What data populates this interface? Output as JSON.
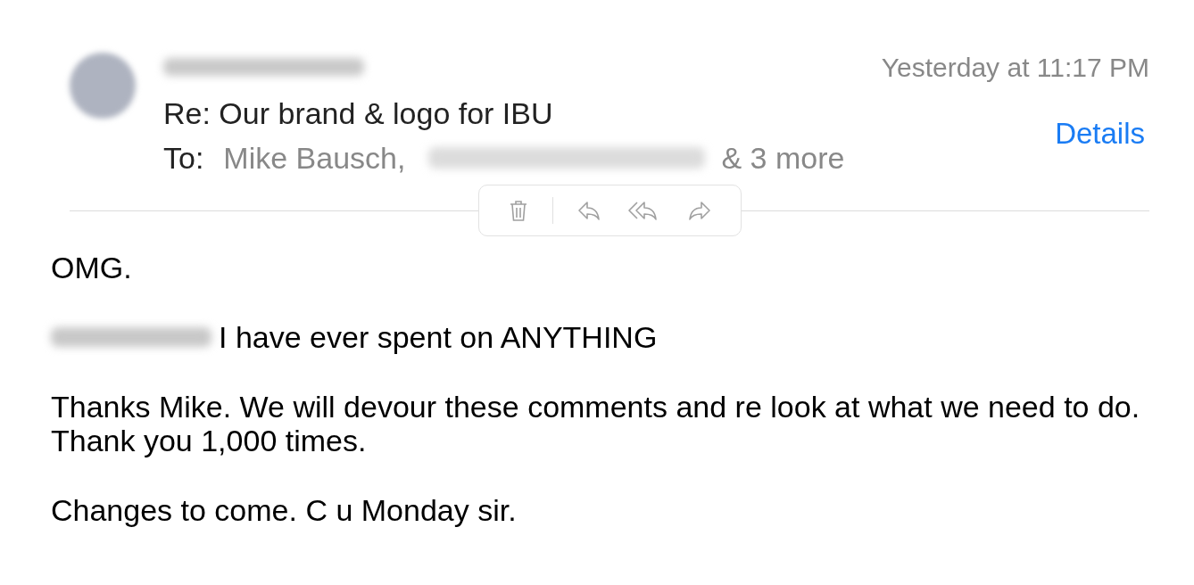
{
  "header": {
    "subject": "Re: Our brand & logo for IBU",
    "to_label": "To:",
    "recipients": [
      "Mike Bausch,"
    ],
    "more": "& 3 more",
    "date": "Yesterday at 11:17 PM",
    "details_link": "Details"
  },
  "toolbar": [
    {
      "kind": "trash"
    },
    {
      "kind": "reply"
    },
    {
      "kind": "reply-all"
    },
    {
      "kind": "forward"
    }
  ],
  "body": [
    {
      "blurred_lead": false,
      "lines": [
        "OMG."
      ]
    },
    {
      "blurred_lead": true,
      "lines": [
        "I have ever spent on ANYTHING"
      ]
    },
    {
      "blurred_lead": false,
      "lines": [
        "Thanks Mike. We will devour these comments and re look at what we need to do.",
        "Thank you 1,000 times."
      ]
    },
    {
      "blurred_lead": false,
      "lines": [
        "Changes to come. C u Monday sir."
      ]
    }
  ]
}
